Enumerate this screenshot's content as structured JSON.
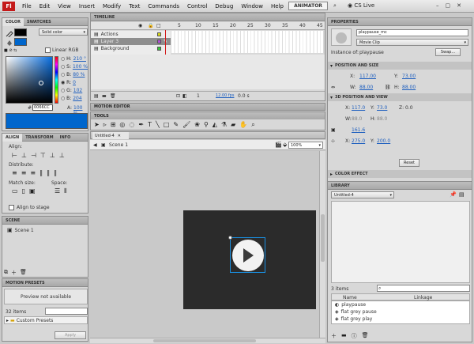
{
  "menubar": {
    "logo": "Fl",
    "items": [
      "File",
      "Edit",
      "View",
      "Insert",
      "Modify",
      "Text",
      "Commands",
      "Control",
      "Debug",
      "Window",
      "Help"
    ],
    "workspace": "ANIMATOR",
    "cs_live": "CS Live"
  },
  "color_panel": {
    "tabs": [
      "COLOR",
      "SWATCHES"
    ],
    "type": "Solid color",
    "linear_rgb": "Linear RGB",
    "h_label": "H:",
    "h_val": "210 °",
    "s_label": "S:",
    "s_val": "100 %",
    "b_label": "B:",
    "b_val": "80 %",
    "r_label": "R:",
    "r_val": "0",
    "g_label": "G:",
    "g_val": "102",
    "bl_label": "B:",
    "bl_val": "204",
    "hex": "0066CC",
    "a_label": "A:",
    "a_val": "100 %",
    "accent": "#0066CC"
  },
  "align_panel": {
    "tabs": [
      "ALIGN",
      "TRANSFORM",
      "INFO"
    ],
    "align": "Align:",
    "distribute": "Distribute:",
    "match": "Match size:",
    "space": "Space:",
    "stage": "Align to stage"
  },
  "scene_panel": {
    "title": "SCENE",
    "scene": "Scene 1"
  },
  "motion_presets": {
    "title": "MOTION PRESETS",
    "preview": "Preview not available",
    "count": "32 items",
    "folder": "Custom Presets",
    "apply": "Apply"
  },
  "timeline": {
    "title": "TIMELINE",
    "layers": [
      "Actions",
      "Layer 3",
      "Background"
    ],
    "frames": [
      "5",
      "10",
      "15",
      "20",
      "25",
      "30",
      "35",
      "40",
      "45"
    ],
    "fps": "12.00 fps",
    "time": "0.0 s",
    "frame": "1"
  },
  "motion_editor": {
    "title": "MOTION EDITOR"
  },
  "tools": {
    "title": "TOOLS"
  },
  "document": {
    "tab": "Untitled-4",
    "scene": "Scene 1",
    "zoom": "100%"
  },
  "properties": {
    "title": "PROPERTIES",
    "instance_name": "playpause_mc",
    "symbol_type": "Movie Clip",
    "instance_of": "Instance of:",
    "instance_of_val": "playpause",
    "swap": "Swap...",
    "pos_size": "POSITION AND SIZE",
    "x_label": "X:",
    "x": "117.00",
    "y_label": "Y:",
    "y": "73.00",
    "w_label": "W:",
    "w": "88.00",
    "h_label": "H:",
    "h": "88.00",
    "p3d": "3D POSITION AND VIEW",
    "x3_label": "X:",
    "x3": "117.0",
    "y3_label": "Y:",
    "y3": "73.0",
    "z3_label": "Z:",
    "z3": "0.0",
    "w3_label": "W:",
    "w3": "88.0",
    "h3_label": "H:",
    "h3": "88.0",
    "persp": "161.6",
    "vx_label": "X:",
    "vx": "275.0",
    "vy_label": "Y:",
    "vy": "200.0",
    "reset": "Reset",
    "color_effect": "COLOR EFFECT"
  },
  "library": {
    "title": "LIBRARY",
    "doc": "Untitled-4",
    "count": "3 items",
    "col_name": "Name",
    "col_link": "Linkage",
    "items": [
      "playpause",
      "flat grey pause",
      "flat grey play"
    ]
  }
}
